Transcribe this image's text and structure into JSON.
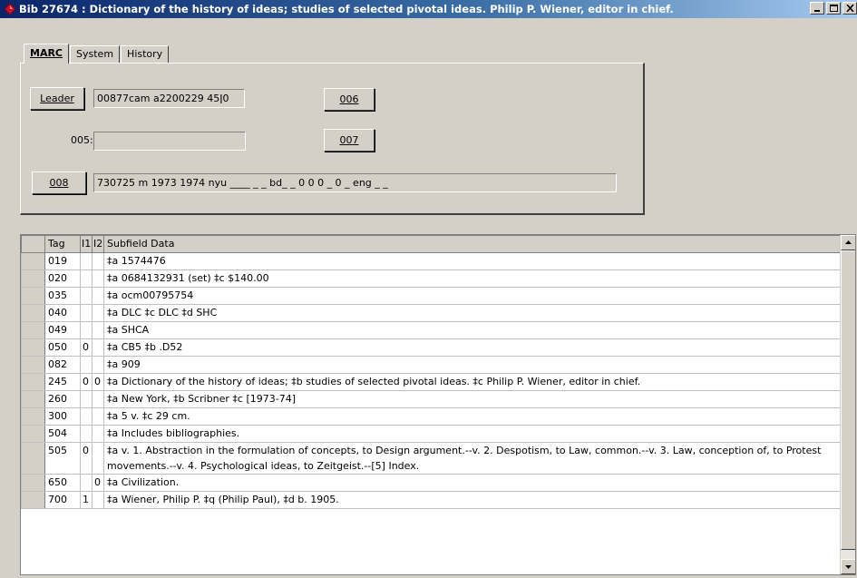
{
  "window": {
    "title": "Bib 27674 : Dictionary of the history of ideas; studies of selected pivotal ideas. Philip P. Wiener, editor in chief."
  },
  "tabs": [
    {
      "label": "MARC",
      "active": true
    },
    {
      "label": "System",
      "active": false
    },
    {
      "label": "History",
      "active": false
    }
  ],
  "marc": {
    "leader_button": "Leader",
    "leader_value": "00877cam a2200229  45ǀ0",
    "button_006": "006",
    "label_005": "005:",
    "value_005": "",
    "button_007": "007",
    "button_008": "008",
    "value_008": "730725 m 1973 1974 nyu ____ _ _ bd_ _ 0 0 0 _ 0 _ eng _ _"
  },
  "grid": {
    "headers": {
      "tag": "Tag",
      "i1": "I1",
      "i2": "I2",
      "data": "Subfield Data"
    },
    "rows": [
      {
        "tag": "019",
        "i1": "",
        "i2": "",
        "data": "‡a 1574476"
      },
      {
        "tag": "020",
        "i1": "",
        "i2": "",
        "data": "‡a 0684132931 (set) ‡c $140.00"
      },
      {
        "tag": "035",
        "i1": "",
        "i2": "",
        "data": "‡a ocm00795754"
      },
      {
        "tag": "040",
        "i1": "",
        "i2": "",
        "data": "‡a DLC ‡c DLC ‡d SHC"
      },
      {
        "tag": "049",
        "i1": "",
        "i2": "",
        "data": "‡a SHCA"
      },
      {
        "tag": "050",
        "i1": "0",
        "i2": "",
        "data": "‡a CB5 ‡b .D52"
      },
      {
        "tag": "082",
        "i1": "",
        "i2": "",
        "data": "‡a 909"
      },
      {
        "tag": "245",
        "i1": "0",
        "i2": "0",
        "data": "‡a Dictionary of the history of ideas; ‡b studies of selected pivotal ideas. ‡c Philip P. Wiener, editor in chief."
      },
      {
        "tag": "260",
        "i1": "",
        "i2": "",
        "data": "‡a New York, ‡b Scribner ‡c [1973-74]"
      },
      {
        "tag": "300",
        "i1": "",
        "i2": "",
        "data": "‡a 5 v. ‡c 29 cm."
      },
      {
        "tag": "504",
        "i1": "",
        "i2": "",
        "data": "‡a Includes bibliographies."
      },
      {
        "tag": "505",
        "i1": "0",
        "i2": "",
        "data": "‡a v. 1. Abstraction in the formulation of concepts, to Design argument.--v. 2. Despotism, to Law, common.--v. 3. Law, conception of, to Protest movements.--v. 4. Psychological ideas, to Zeitgeist.--[5] Index."
      },
      {
        "tag": "650",
        "i1": "",
        "i2": "0",
        "data": "‡a Civilization."
      },
      {
        "tag": "700",
        "i1": "1",
        "i2": "",
        "data": "‡a Wiener, Philip P. ‡q (Philip Paul), ‡d b. 1905."
      }
    ]
  },
  "icons": {
    "app": "diamond-app-icon",
    "minimize": "minimize-icon",
    "maximize": "maximize-icon",
    "close": "close-icon",
    "scroll_up": "scroll-up-arrow-icon",
    "scroll_down": "scroll-down-arrow-icon"
  },
  "colors": {
    "titlebar_start": "#0a246a",
    "titlebar_end": "#a6caf0",
    "face": "#d4d0c8",
    "icon_red": "#c8102e"
  }
}
